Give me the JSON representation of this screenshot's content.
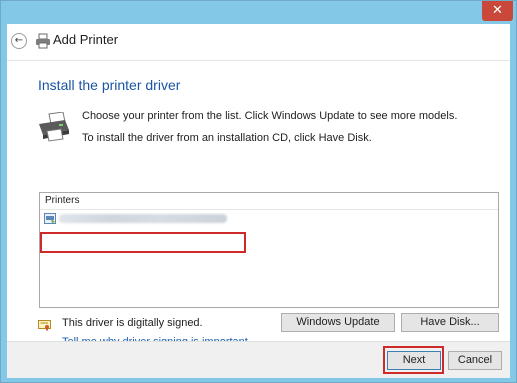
{
  "window": {
    "title": "Add Printer",
    "close_label": "✕"
  },
  "header": {
    "back_label": "←",
    "title": "Add Printer"
  },
  "page": {
    "title": "Install the printer driver",
    "description_line1": "Choose your printer from the list. Click Windows Update to see more models.",
    "description_line2": "To install the driver from an installation CD, click Have Disk."
  },
  "printers_list": {
    "header": "Printers",
    "items": [
      {
        "name_redacted": true
      }
    ]
  },
  "signing": {
    "status_text": "This driver is digitally signed.",
    "link_text": "Tell me why driver signing is important"
  },
  "buttons": {
    "windows_update": "Windows Update",
    "have_disk": "Have Disk...",
    "next": "Next",
    "cancel": "Cancel"
  },
  "colors": {
    "window_frame": "#84c8e7",
    "close_button": "#c9483a",
    "title_text": "#1a56a4",
    "link_text": "#1a5fb4",
    "annotation_highlight": "#cf2a2a"
  },
  "icons": {
    "back": "back-arrow-icon",
    "printer_small": "printer-icon",
    "printer_large": "printer-install-icon",
    "list_item": "printer-item-icon",
    "signature": "certificate-icon"
  }
}
